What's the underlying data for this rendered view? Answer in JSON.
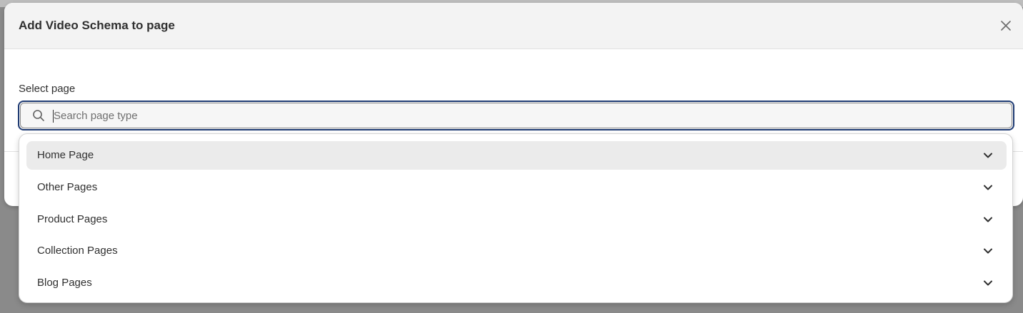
{
  "modal": {
    "title": "Add Video Schema to page"
  },
  "form": {
    "label": "Select page",
    "search_placeholder": "Search page type",
    "search_value": ""
  },
  "dropdown": {
    "options": [
      {
        "label": "Home Page",
        "active": true
      },
      {
        "label": "Other Pages",
        "active": false
      },
      {
        "label": "Product Pages",
        "active": false
      },
      {
        "label": "Collection Pages",
        "active": false
      },
      {
        "label": "Blog Pages",
        "active": false
      }
    ]
  },
  "icons": {
    "close": "close-icon",
    "search": "search-icon",
    "chevron": "chevron-down-icon"
  },
  "colors": {
    "focus_ring": "#1f3b73",
    "active_option": "#ebebeb",
    "header_bg": "#f3f3f3",
    "overlay": "#8a8a8a"
  }
}
